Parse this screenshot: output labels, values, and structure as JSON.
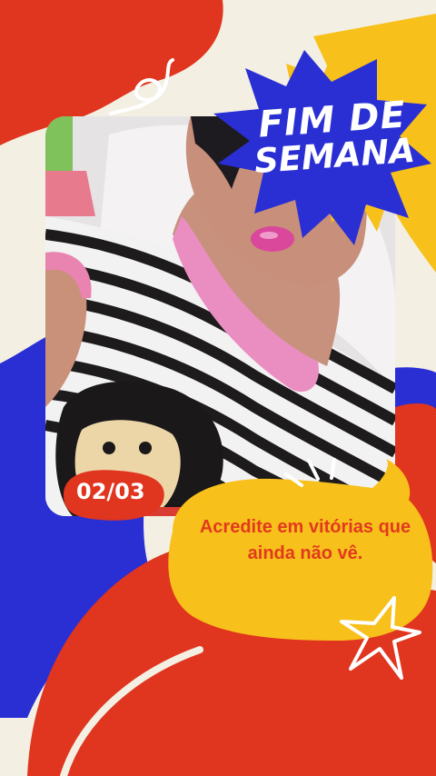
{
  "burst": {
    "line1": "FIM DE",
    "line2": "SEMANA"
  },
  "counter": "02/03",
  "quote": "Acredite em vitórias que ainda não vê.",
  "colors": {
    "background": "#f3efe3",
    "red": "#e0351e",
    "blue": "#2a2fd4",
    "yellow": "#f7c01a",
    "white": "#ffffff"
  },
  "icons": [
    "squiggle-icon",
    "burst-icon",
    "spark-lines-icon",
    "star-outline-icon"
  ]
}
